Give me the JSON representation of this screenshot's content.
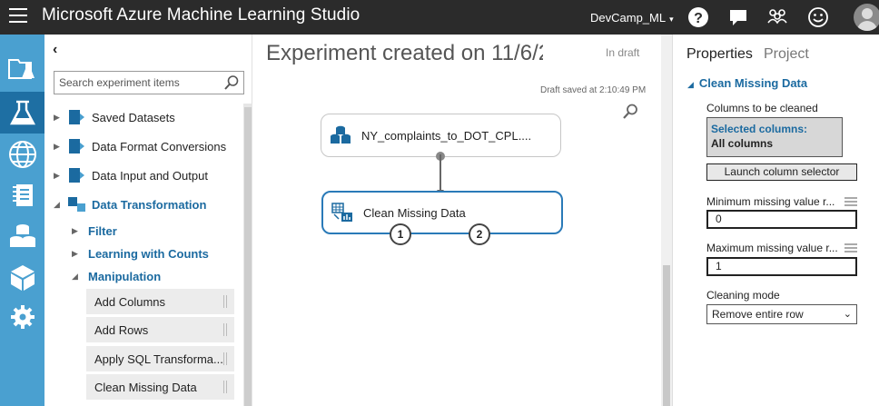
{
  "app": {
    "title": "Microsoft Azure Machine Learning Studio",
    "workspace": "DevCamp_ML",
    "workspace_caret": "▾",
    "icons": [
      "help-icon",
      "feedback-icon",
      "community-icon",
      "smiley-icon",
      "user-avatar"
    ]
  },
  "leftnav": {
    "items": [
      "projects-icon",
      "experiments-icon",
      "web-services-icon",
      "notebooks-icon",
      "datasets-icon",
      "trained-models-icon",
      "settings-icon"
    ],
    "active": "experiments-icon"
  },
  "palette": {
    "collapse_glyph": "‹",
    "search_placeholder": "Search experiment items",
    "categories": [
      {
        "label": "Saved Datasets",
        "arrow": "▶"
      },
      {
        "label": "Data Format Conversions",
        "arrow": "▶"
      },
      {
        "label": "Data Input and Output",
        "arrow": "▶"
      },
      {
        "label": "Data Transformation",
        "arrow": "◢"
      }
    ],
    "subcategories": [
      {
        "label": "Filter",
        "arrow": "▶"
      },
      {
        "label": "Learning with Counts",
        "arrow": "▶"
      },
      {
        "label": "Manipulation",
        "arrow": "◢"
      }
    ],
    "modules": [
      "Add Columns",
      "Add Rows",
      "Apply SQL Transforma...",
      "Clean Missing Data"
    ]
  },
  "canvas": {
    "experiment_title": "Experiment created on 11/6/2",
    "state": "In draft",
    "draft_saved": "Draft saved at 2:10:49 PM",
    "nodes": {
      "dataset": {
        "label": "NY_complaints_to_DOT_CPL...."
      },
      "clean": {
        "label": "Clean Missing Data",
        "port1": "1",
        "port2": "2"
      }
    }
  },
  "properties": {
    "tab_properties": "Properties",
    "tab_project": "Project",
    "module_name": "Clean Missing Data",
    "module_arrow": "◢",
    "columns_label": "Columns to be cleaned",
    "selected_columns_title": "Selected columns:",
    "selected_columns_value": "All columns",
    "launch_button": "Launch column selector",
    "min_label": "Minimum missing value r...",
    "min_value": "0",
    "max_label": "Maximum missing value r...",
    "max_value": "1",
    "mode_label": "Cleaning mode",
    "mode_value": "Remove entire row",
    "mode_chevron": "⌄"
  },
  "colors": {
    "topbar": "#2b2b2b",
    "leftnav": "#4aa0d0",
    "leftnav_active": "#1e6fa3",
    "accent": "#1b6aa0",
    "node_selected": "#2a7ab8"
  }
}
